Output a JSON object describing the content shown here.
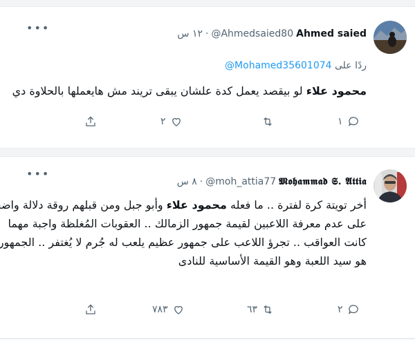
{
  "tweets": [
    {
      "author_name": "Ahmed saied",
      "handle": "@Ahmedsaied80",
      "separator": "·",
      "time": "١٢ س",
      "reply_prefix": "ردًا على",
      "reply_to": "@Mohamed35601074",
      "text_bold": "محمود علاء",
      "text_rest": "لو بيقصد يعمل كدة علشان يبقى تريند مش هايعملها بالحلاوة دي",
      "more_label": "•••",
      "counts": {
        "reply": "١",
        "retweet": "",
        "like": "٢",
        "share": ""
      },
      "avatar_colors": {
        "sky": "#5b7fa6",
        "mountain": "#8a9bb0",
        "ground": "#4a3a2c",
        "figure": "#1e1b1a"
      }
    },
    {
      "author_name": "𝕸𝖔𝖍𝖆𝖒𝖒𝖆𝖉 𝕾. 𝕬𝖙𝖙𝖎𝖆",
      "handle": "@moh_attia77",
      "separator": "·",
      "time": "٨ س",
      "more_label": "•••",
      "text_line1_a": "أخر تويتة كرة لفترة .. ما فعله ",
      "text_bold": "محمود علاء",
      "text_line1_b": " وأبو جبل ومن قبلهم روقة دلالة واضحة",
      "text_line2": "على عدم معرفة اللاعبين لقيمة جمهور الزمالك .. العقوبات المُغلظة واجبة مهما",
      "text_line3": "كانت العواقب .. تجرؤ اللاعب على جمهور عظيم يلعب له جُرم لا يُغتفر .. الجمهور",
      "text_line4": "هو سيد اللعبة وهو القيمة الأساسية للنادى",
      "counts": {
        "reply": "٢",
        "retweet": "٦٣",
        "like": "٧٨٣",
        "share": ""
      },
      "avatar_colors": {
        "bg": "#d9d9d9",
        "face": "#c9a48a",
        "hair": "#4a4a4a",
        "shirt": "#2b2f3a"
      }
    }
  ],
  "icons": {
    "reply": "reply-icon",
    "retweet": "retweet-icon",
    "like": "heart-icon",
    "share": "share-icon",
    "more": "more-icon"
  },
  "colors": {
    "link": "#1d9bf0",
    "muted": "#536471",
    "text": "#0f1419",
    "divider": "#e6ecf0"
  }
}
